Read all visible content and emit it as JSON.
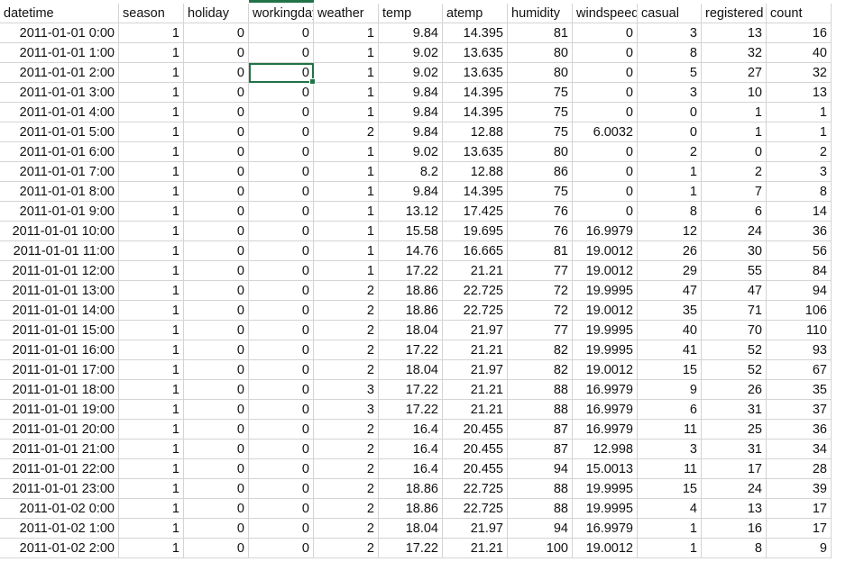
{
  "sheet": {
    "columns": [
      "datetime",
      "season",
      "holiday",
      "workingday",
      "weather",
      "temp",
      "atemp",
      "humidity",
      "windspeed",
      "casual",
      "registered",
      "count"
    ],
    "selected_cell": {
      "row": 2,
      "col": 3
    },
    "rows": [
      [
        "2011-01-01 0:00",
        "1",
        "0",
        "0",
        "1",
        "9.84",
        "14.395",
        "81",
        "0",
        "3",
        "13",
        "16"
      ],
      [
        "2011-01-01 1:00",
        "1",
        "0",
        "0",
        "1",
        "9.02",
        "13.635",
        "80",
        "0",
        "8",
        "32",
        "40"
      ],
      [
        "2011-01-01 2:00",
        "1",
        "0",
        "0",
        "1",
        "9.02",
        "13.635",
        "80",
        "0",
        "5",
        "27",
        "32"
      ],
      [
        "2011-01-01 3:00",
        "1",
        "0",
        "0",
        "1",
        "9.84",
        "14.395",
        "75",
        "0",
        "3",
        "10",
        "13"
      ],
      [
        "2011-01-01 4:00",
        "1",
        "0",
        "0",
        "1",
        "9.84",
        "14.395",
        "75",
        "0",
        "0",
        "1",
        "1"
      ],
      [
        "2011-01-01 5:00",
        "1",
        "0",
        "0",
        "2",
        "9.84",
        "12.88",
        "75",
        "6.0032",
        "0",
        "1",
        "1"
      ],
      [
        "2011-01-01 6:00",
        "1",
        "0",
        "0",
        "1",
        "9.02",
        "13.635",
        "80",
        "0",
        "2",
        "0",
        "2"
      ],
      [
        "2011-01-01 7:00",
        "1",
        "0",
        "0",
        "1",
        "8.2",
        "12.88",
        "86",
        "0",
        "1",
        "2",
        "3"
      ],
      [
        "2011-01-01 8:00",
        "1",
        "0",
        "0",
        "1",
        "9.84",
        "14.395",
        "75",
        "0",
        "1",
        "7",
        "8"
      ],
      [
        "2011-01-01 9:00",
        "1",
        "0",
        "0",
        "1",
        "13.12",
        "17.425",
        "76",
        "0",
        "8",
        "6",
        "14"
      ],
      [
        "2011-01-01 10:00",
        "1",
        "0",
        "0",
        "1",
        "15.58",
        "19.695",
        "76",
        "16.9979",
        "12",
        "24",
        "36"
      ],
      [
        "2011-01-01 11:00",
        "1",
        "0",
        "0",
        "1",
        "14.76",
        "16.665",
        "81",
        "19.0012",
        "26",
        "30",
        "56"
      ],
      [
        "2011-01-01 12:00",
        "1",
        "0",
        "0",
        "1",
        "17.22",
        "21.21",
        "77",
        "19.0012",
        "29",
        "55",
        "84"
      ],
      [
        "2011-01-01 13:00",
        "1",
        "0",
        "0",
        "2",
        "18.86",
        "22.725",
        "72",
        "19.9995",
        "47",
        "47",
        "94"
      ],
      [
        "2011-01-01 14:00",
        "1",
        "0",
        "0",
        "2",
        "18.86",
        "22.725",
        "72",
        "19.0012",
        "35",
        "71",
        "106"
      ],
      [
        "2011-01-01 15:00",
        "1",
        "0",
        "0",
        "2",
        "18.04",
        "21.97",
        "77",
        "19.9995",
        "40",
        "70",
        "110"
      ],
      [
        "2011-01-01 16:00",
        "1",
        "0",
        "0",
        "2",
        "17.22",
        "21.21",
        "82",
        "19.9995",
        "41",
        "52",
        "93"
      ],
      [
        "2011-01-01 17:00",
        "1",
        "0",
        "0",
        "2",
        "18.04",
        "21.97",
        "82",
        "19.0012",
        "15",
        "52",
        "67"
      ],
      [
        "2011-01-01 18:00",
        "1",
        "0",
        "0",
        "3",
        "17.22",
        "21.21",
        "88",
        "16.9979",
        "9",
        "26",
        "35"
      ],
      [
        "2011-01-01 19:00",
        "1",
        "0",
        "0",
        "3",
        "17.22",
        "21.21",
        "88",
        "16.9979",
        "6",
        "31",
        "37"
      ],
      [
        "2011-01-01 20:00",
        "1",
        "0",
        "0",
        "2",
        "16.4",
        "20.455",
        "87",
        "16.9979",
        "11",
        "25",
        "36"
      ],
      [
        "2011-01-01 21:00",
        "1",
        "0",
        "0",
        "2",
        "16.4",
        "20.455",
        "87",
        "12.998",
        "3",
        "31",
        "34"
      ],
      [
        "2011-01-01 22:00",
        "1",
        "0",
        "0",
        "2",
        "16.4",
        "20.455",
        "94",
        "15.0013",
        "11",
        "17",
        "28"
      ],
      [
        "2011-01-01 23:00",
        "1",
        "0",
        "0",
        "2",
        "18.86",
        "22.725",
        "88",
        "19.9995",
        "15",
        "24",
        "39"
      ],
      [
        "2011-01-02 0:00",
        "1",
        "0",
        "0",
        "2",
        "18.86",
        "22.725",
        "88",
        "19.9995",
        "4",
        "13",
        "17"
      ],
      [
        "2011-01-02 1:00",
        "1",
        "0",
        "0",
        "2",
        "18.04",
        "21.97",
        "94",
        "16.9979",
        "1",
        "16",
        "17"
      ],
      [
        "2011-01-02 2:00",
        "1",
        "0",
        "0",
        "2",
        "17.22",
        "21.21",
        "100",
        "19.0012",
        "1",
        "8",
        "9"
      ]
    ]
  },
  "colors": {
    "gridline": "#d4d4d4",
    "selection": "#217346",
    "text": "#111111",
    "background": "#ffffff"
  }
}
